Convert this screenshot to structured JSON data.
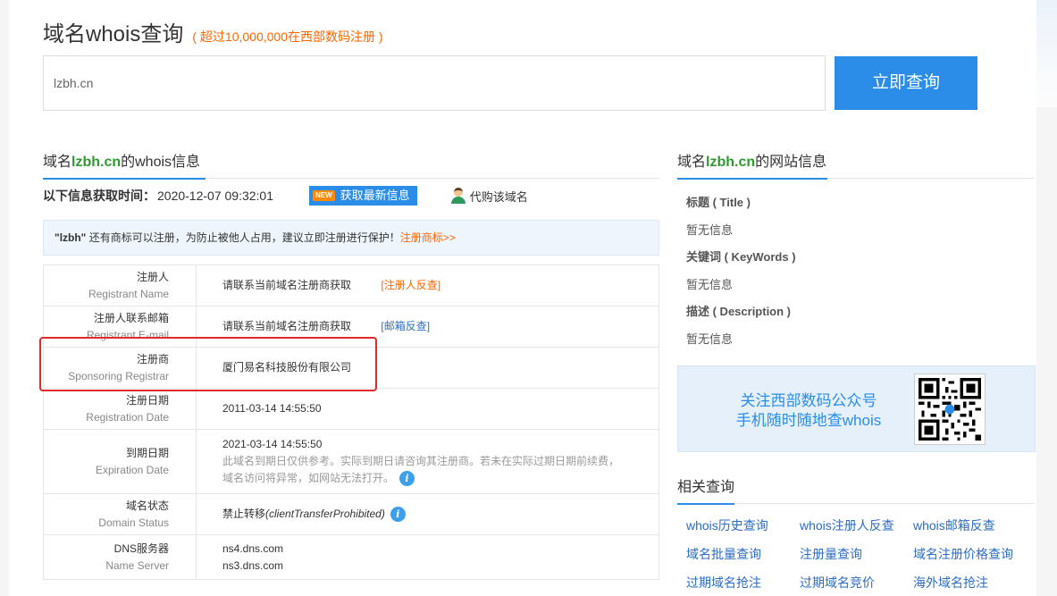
{
  "header": {
    "title": "域名whois查询",
    "subtitle": "( 超过10,000,000在西部数码注册 )"
  },
  "search": {
    "value": "lzbh.cn",
    "button_label": "立即查询"
  },
  "whois_section": {
    "head_prefix": "域名",
    "domain": "lzbh.cn",
    "head_suffix": "的whois信息",
    "time_label": "以下信息获取时间：",
    "time_value": "2020-12-07 09:32:01",
    "new_badge": "NEW",
    "refresh_label": "获取最新信息",
    "agent_label": "代购该域名"
  },
  "notice": {
    "keyword": "\"lzbh\"",
    "text": " 还有商标可以注册，为防止被他人占用，建议立即注册进行保护！",
    "link": "注册商标>>"
  },
  "whois_table": {
    "registrant": {
      "label_cn": "注册人",
      "label_en": "Registrant Name",
      "value": "请联系当前域名注册商获取",
      "link": "[注册人反查]"
    },
    "email": {
      "label_cn": "注册人联系邮箱",
      "label_en": "Registrant E-mail",
      "value": "请联系当前域名注册商获取",
      "link": "[邮箱反查]"
    },
    "registrar": {
      "label_cn": "注册商",
      "label_en": "Sponsoring Registrar",
      "value": "厦门易名科技股份有限公司"
    },
    "reg_date": {
      "label_cn": "注册日期",
      "label_en": "Registration Date",
      "value": "2011-03-14 14:55:50"
    },
    "exp_date": {
      "label_cn": "到期日期",
      "label_en": "Expiration Date",
      "value": "2021-03-14 14:55:50",
      "note_1": "此域名到期日仅供参考。实际到期日请咨询其注册商。若未在实际过期日期前续费，",
      "note_2": "域名访问将异常，如网站无法打开。"
    },
    "status": {
      "label_cn": "域名状态",
      "label_en": "Domain Status",
      "value": "禁止转移",
      "code": "(clientTransferProhibited)"
    },
    "dns": {
      "label_cn": "DNS服务器",
      "label_en": "Name Server",
      "ns1": "ns4.dns.com",
      "ns2": "ns3.dns.com"
    }
  },
  "site_section": {
    "head_prefix": "域名",
    "domain": "lzbh.cn",
    "head_suffix": "的网站信息",
    "title_key": "标题 ( Title )",
    "title_val": "暂无信息",
    "keywords_key": "关键词 ( KeyWords )",
    "keywords_val": "暂无信息",
    "desc_key": "描述 ( Description )",
    "desc_val": "暂无信息"
  },
  "wechat": {
    "line1": "关注西部数码公众号",
    "line2": "手机随时随地查whois"
  },
  "related": {
    "title": "相关查询",
    "links": [
      "whois历史查询",
      "whois注册人反查",
      "whois邮箱反查",
      "域名批量查询",
      "注册量查询",
      "域名注册价格查询",
      "过期域名抢注",
      "过期域名竞价",
      "海外域名抢注"
    ]
  },
  "colors": {
    "accent": "#2b8de8",
    "highlight": "#ff6600",
    "domain_green": "#2e9a2e",
    "annotation_red": "#e12a2a"
  }
}
